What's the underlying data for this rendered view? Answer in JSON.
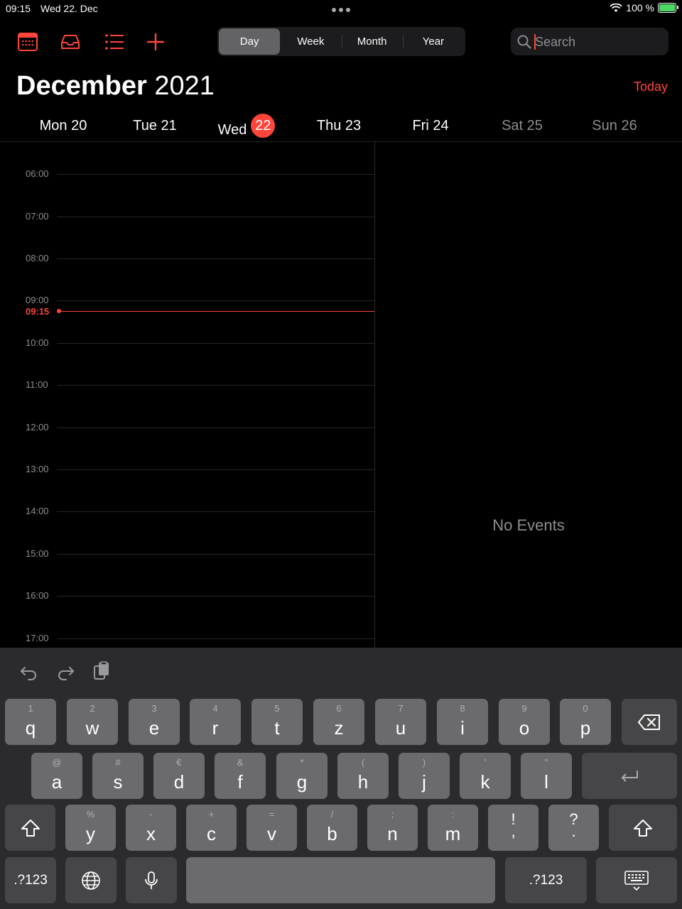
{
  "status_bar": {
    "time": "09:15",
    "date": "Wed 22. Dec",
    "battery": "100 %"
  },
  "toolbar": {
    "segments": [
      "Day",
      "Week",
      "Month",
      "Year"
    ],
    "active_segment": "Day",
    "search_placeholder": "Search"
  },
  "header": {
    "month": "December",
    "year": "2021",
    "today_label": "Today"
  },
  "weekdays": [
    {
      "label": "Mon 20"
    },
    {
      "label": "Tue 21"
    },
    {
      "label": "Wed",
      "badge": "22"
    },
    {
      "label": "Thu 23"
    },
    {
      "label": "Fri 24"
    },
    {
      "label": "Sat 25"
    },
    {
      "label": "Sun 26"
    }
  ],
  "timeline": {
    "hours": [
      "06:00",
      "07:00",
      "08:00",
      "09:00",
      "10:00",
      "11:00",
      "12:00",
      "13:00",
      "14:00",
      "15:00",
      "16:00",
      "17:00"
    ],
    "now": "09:15"
  },
  "detail": {
    "empty_text": "No Events"
  },
  "colors": {
    "accent": "#ff453a",
    "background": "#000000",
    "keyboard": "#2b2b2d",
    "key": "#6b6b6e"
  },
  "keyboard": {
    "toolbar_icons": [
      "undo-icon",
      "redo-icon",
      "clipboard-icon"
    ],
    "row1": [
      {
        "sub": "1",
        "main": "q"
      },
      {
        "sub": "2",
        "main": "w"
      },
      {
        "sub": "3",
        "main": "e"
      },
      {
        "sub": "4",
        "main": "r"
      },
      {
        "sub": "5",
        "main": "t"
      },
      {
        "sub": "6",
        "main": "z"
      },
      {
        "sub": "7",
        "main": "u"
      },
      {
        "sub": "8",
        "main": "i"
      },
      {
        "sub": "9",
        "main": "o"
      },
      {
        "sub": "0",
        "main": "p"
      }
    ],
    "row2": [
      {
        "sub": "@",
        "main": "a"
      },
      {
        "sub": "#",
        "main": "s"
      },
      {
        "sub": "€",
        "main": "d"
      },
      {
        "sub": "&",
        "main": "f"
      },
      {
        "sub": "*",
        "main": "g"
      },
      {
        "sub": "(",
        "main": "h"
      },
      {
        "sub": ")",
        "main": "j"
      },
      {
        "sub": "'",
        "main": "k"
      },
      {
        "sub": "\"",
        "main": "l"
      }
    ],
    "row3": [
      {
        "sub": "%",
        "main": "y"
      },
      {
        "sub": "-",
        "main": "x"
      },
      {
        "sub": "+",
        "main": "c"
      },
      {
        "sub": "=",
        "main": "v"
      },
      {
        "sub": "/",
        "main": "b"
      },
      {
        "sub": ";",
        "main": "n"
      },
      {
        "sub": ":",
        "main": "m"
      },
      {
        "sub": "!",
        "main": ","
      },
      {
        "sub": "?",
        "main": "."
      }
    ],
    "numbers_label": ".?123"
  }
}
